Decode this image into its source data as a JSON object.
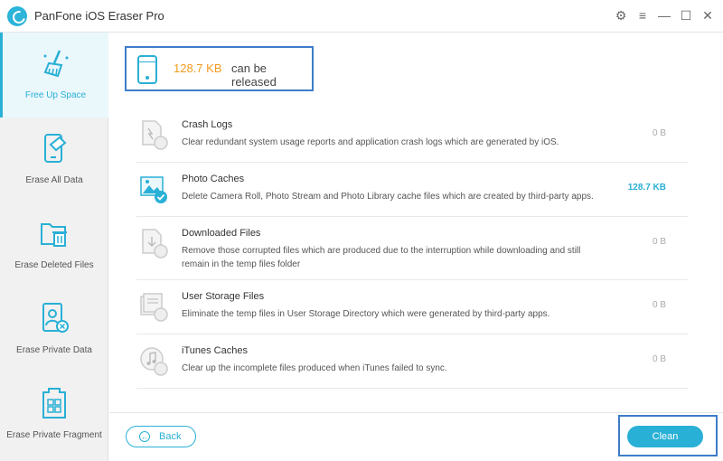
{
  "app": {
    "title": "PanFone iOS Eraser Pro"
  },
  "window_controls": {
    "settings_icon": "⚙",
    "menu_icon": "≡",
    "minimize_icon": "—",
    "maximize_icon": "☐",
    "close_icon": "✕"
  },
  "sidebar": {
    "items": [
      {
        "label": "Free Up Space",
        "icon": "broom-icon",
        "active": true
      },
      {
        "label": "Erase All Data",
        "icon": "phone-erase-icon",
        "active": false
      },
      {
        "label": "Erase Deleted Files",
        "icon": "folder-trash-icon",
        "active": false
      },
      {
        "label": "Erase Private Data",
        "icon": "private-user-icon",
        "active": false
      },
      {
        "label": "Erase Private Fragment",
        "icon": "fragment-grid-icon",
        "active": false
      }
    ]
  },
  "summary": {
    "size": "128.7 KB",
    "text": "can be released"
  },
  "categories": [
    {
      "title": "Crash Logs",
      "desc": "Clear redundant system usage reports and application crash logs which are generated by iOS.",
      "size": "0 B",
      "selected": false
    },
    {
      "title": "Photo Caches",
      "desc": "Delete Camera Roll, Photo Stream and Photo Library cache files which are created by third-party apps.",
      "size": "128.7 KB",
      "selected": true
    },
    {
      "title": "Downloaded Files",
      "desc": "Remove those corrupted files which are produced due to the interruption while downloading and still remain in the temp files folder",
      "size": "0 B",
      "selected": false
    },
    {
      "title": "User Storage Files",
      "desc": "Eliminate the temp files in User Storage Directory which were generated by third-party apps.",
      "size": "0 B",
      "selected": false
    },
    {
      "title": "iTunes Caches",
      "desc": "Clear up the incomplete files produced when iTunes failed to sync.",
      "size": "0 B",
      "selected": false
    }
  ],
  "footer": {
    "back_label": "Back",
    "clean_label": "Clean"
  },
  "colors": {
    "accent": "#29b0d6",
    "highlight_border": "#3d7cc9",
    "size_orange": "#f39a1f"
  }
}
